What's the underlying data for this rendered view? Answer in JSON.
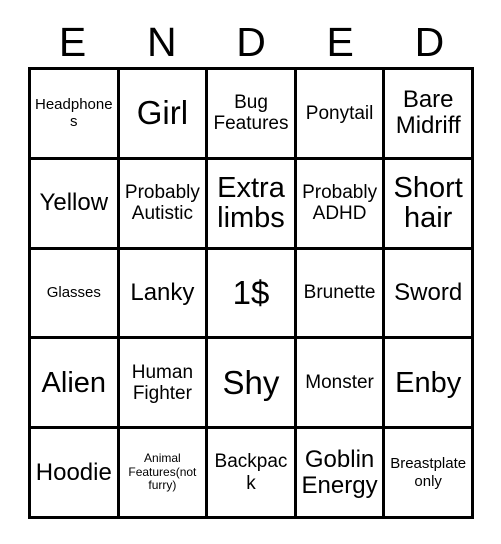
{
  "card": {
    "header_letters": [
      "E",
      "N",
      "D",
      "E",
      "D"
    ],
    "columns": 5,
    "rows": 5,
    "colors": {
      "background": "#ffffff",
      "grid_line": "#000000",
      "text": "#000000"
    },
    "cells": [
      [
        {
          "label": "Headphones",
          "size": "t-sm"
        },
        {
          "label": "Girl",
          "size": "t-xxl"
        },
        {
          "label": "Bug Features",
          "size": "t-md"
        },
        {
          "label": "Ponytail",
          "size": "t-md"
        },
        {
          "label": "Bare Midriff",
          "size": "t-lg"
        }
      ],
      [
        {
          "label": "Yellow",
          "size": "t-lg"
        },
        {
          "label": "Probably Autistic",
          "size": "t-md"
        },
        {
          "label": "Extra limbs",
          "size": "t-xl"
        },
        {
          "label": "Probably ADHD",
          "size": "t-md"
        },
        {
          "label": "Short hair",
          "size": "t-xl"
        }
      ],
      [
        {
          "label": "Glasses",
          "size": "t-sm"
        },
        {
          "label": "Lanky",
          "size": "t-lg"
        },
        {
          "label": "1$",
          "size": "t-xxl"
        },
        {
          "label": "Brunette",
          "size": "t-md"
        },
        {
          "label": "Sword",
          "size": "t-lg"
        }
      ],
      [
        {
          "label": "Alien",
          "size": "t-xl"
        },
        {
          "label": "Human Fighter",
          "size": "t-md"
        },
        {
          "label": "Shy",
          "size": "t-xxl"
        },
        {
          "label": "Monster",
          "size": "t-md"
        },
        {
          "label": "Enby",
          "size": "t-xl"
        }
      ],
      [
        {
          "label": "Hoodie",
          "size": "t-lg"
        },
        {
          "label": "Animal Features(not furry)",
          "size": "t-xs"
        },
        {
          "label": "Backpack",
          "size": "t-md"
        },
        {
          "label": "Goblin Energy",
          "size": "t-lg"
        },
        {
          "label": "Breastplate only",
          "size": "t-sm"
        }
      ]
    ]
  }
}
